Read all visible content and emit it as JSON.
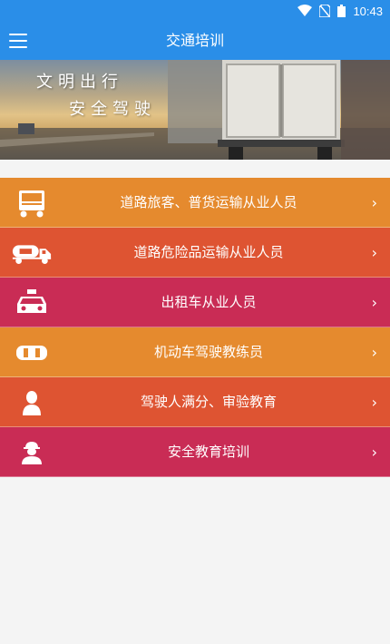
{
  "status": {
    "time": "10:43"
  },
  "app": {
    "title": "交通培训"
  },
  "banner": {
    "line1": "文明出行",
    "line2": "安全驾驶"
  },
  "menu": [
    {
      "label": "道路旅客、普货运输从业人员",
      "color": "#e58a2e",
      "icon": "truck-icon"
    },
    {
      "label": "道路危险品运输从业人员",
      "color": "#de5432",
      "icon": "tanker-truck-icon"
    },
    {
      "label": "出租车从业人员",
      "color": "#c92c55",
      "icon": "taxi-icon"
    },
    {
      "label": "机动车驾驶教练员",
      "color": "#e58a2e",
      "icon": "car-topview-icon"
    },
    {
      "label": "驾驶人满分、审验教育",
      "color": "#de5432",
      "icon": "person-icon"
    },
    {
      "label": "安全教育培训",
      "color": "#c92c55",
      "icon": "worker-icon"
    }
  ],
  "chevron": "›"
}
